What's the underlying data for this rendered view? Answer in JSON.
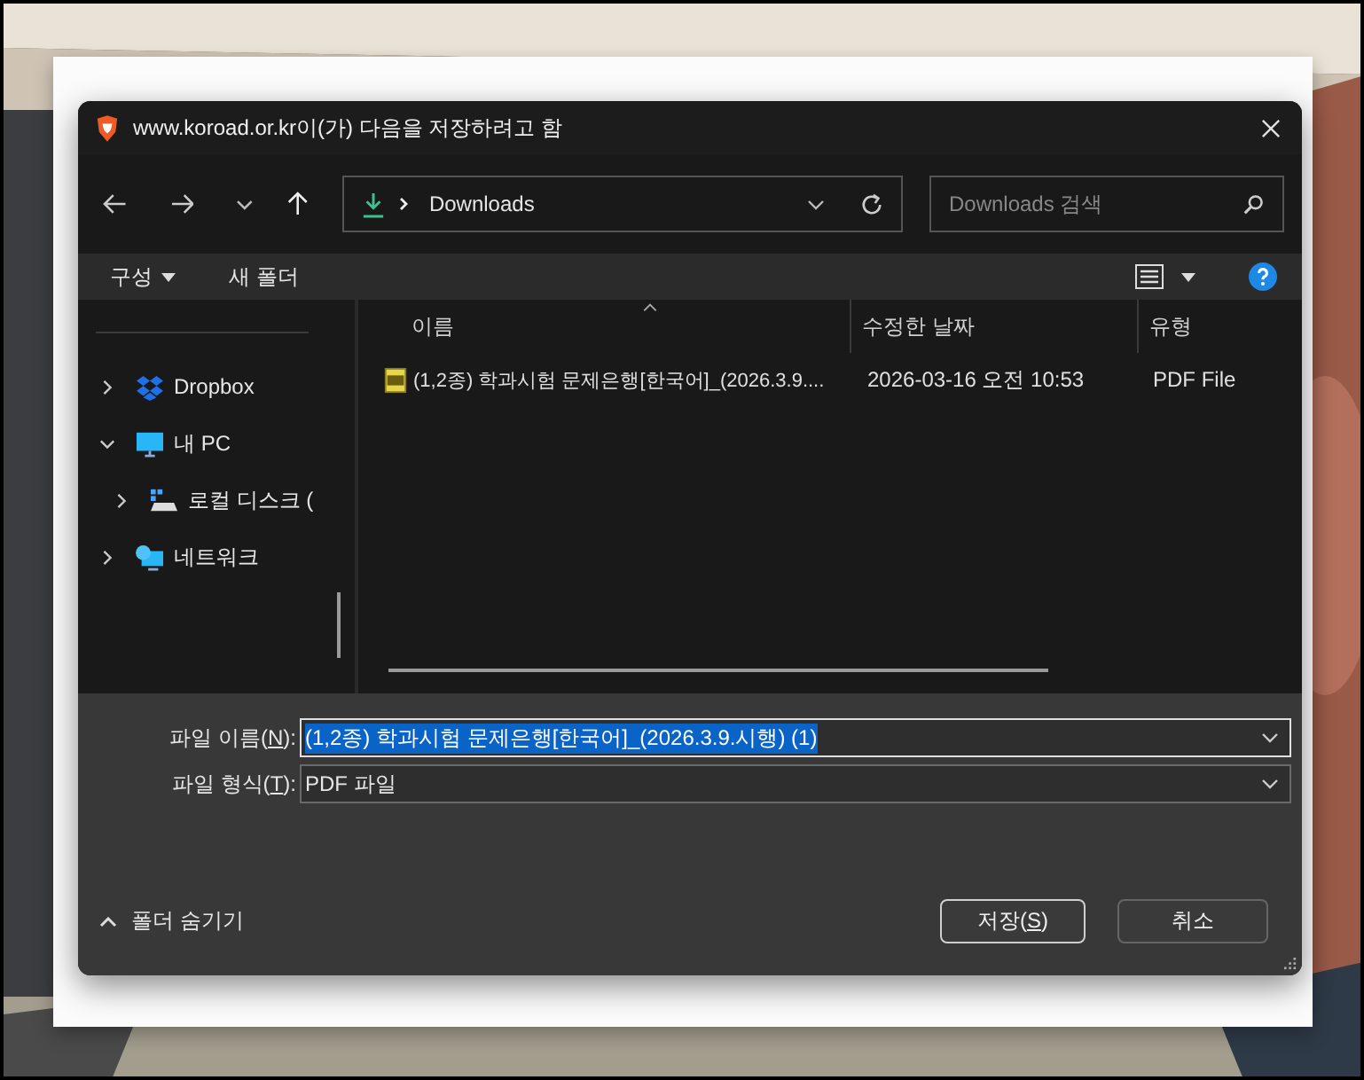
{
  "dialog": {
    "title": "www.koroad.or.kr이(가) 다음을 저장하려고 함"
  },
  "address": {
    "path": "Downloads"
  },
  "search": {
    "placeholder": "Downloads 검색"
  },
  "toolbar": {
    "organize": "구성",
    "new_folder": "새 폴더"
  },
  "sidebar": {
    "items": [
      {
        "label": "Dropbox",
        "expanded": false
      },
      {
        "label": "내 PC",
        "expanded": true,
        "children": [
          {
            "label": "로컬 디스크 (",
            "expanded": false
          }
        ]
      },
      {
        "label": "네트워크",
        "expanded": false
      }
    ]
  },
  "table": {
    "columns": [
      "이름",
      "수정한 날짜",
      "유형"
    ],
    "rows": [
      {
        "name": "(1,2종) 학과시험 문제은행[한국어]_(2026.3.9....",
        "modified": "2026-03-16 오전 10:53",
        "type": "PDF File",
        "selected": false
      }
    ]
  },
  "form": {
    "filename": {
      "label": "파일 이름(",
      "accel": "N",
      "label_end": "):",
      "value": "(1,2종) 학과시험 문제은행[한국어]_(2026.3.9.시행) (1)",
      "text_selected": true
    },
    "filetype": {
      "label": "파일 형식(",
      "accel": "T",
      "label_end": "):",
      "value": "PDF 파일"
    }
  },
  "hide_folders": "폴더 숨기기",
  "buttons": [
    {
      "label": "저장(",
      "accel": "S",
      "label_end": ")",
      "default": true
    },
    {
      "label": "취소",
      "default": false
    }
  ]
}
